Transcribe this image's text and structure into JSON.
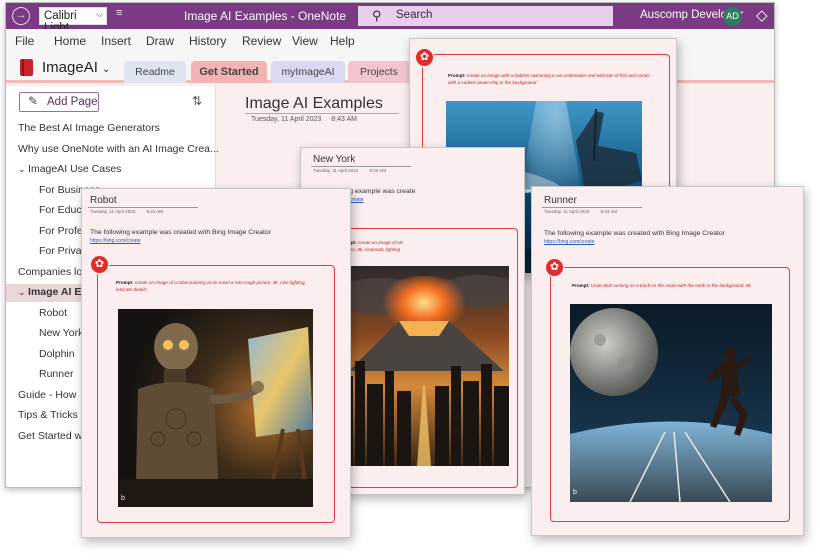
{
  "window": {
    "font_name": "Calibri Light",
    "title": "Image AI Examples  -  OneNote",
    "search_placeholder": "Search",
    "user_name": "Auscomp Developer",
    "user_initials": "AD"
  },
  "menu": [
    "File",
    "Home",
    "Insert",
    "Draw",
    "History",
    "Review",
    "View",
    "Help"
  ],
  "notebook": {
    "name": "ImageAI",
    "sections": [
      {
        "label": "Readme",
        "color": "#dfe4f3"
      },
      {
        "label": "Get Started",
        "color": "#f4b3b3"
      },
      {
        "label": "myImageAI",
        "color": "#dcd8ef"
      },
      {
        "label": "Projects",
        "color": "#f3c5cf"
      }
    ]
  },
  "sidebar": {
    "add_page": "Add Page",
    "pages": [
      {
        "label": "The Best AI Image Generators",
        "indent": 0
      },
      {
        "label": "Why use OneNote with an AI Image Crea...",
        "indent": 0
      },
      {
        "label": "ImageAI Use Cases",
        "indent": 0,
        "group": "expanded"
      },
      {
        "label": "For Business",
        "indent": 1
      },
      {
        "label": "For Educat",
        "indent": 1
      },
      {
        "label": "For Profess",
        "indent": 1
      },
      {
        "label": "For Private",
        "indent": 1
      },
      {
        "label": "Companies lo",
        "indent": 0
      },
      {
        "label": "Image AI Exa",
        "indent": 0,
        "group": "expanded",
        "selected": true
      },
      {
        "label": "Robot",
        "indent": 1
      },
      {
        "label": "New York",
        "indent": 1
      },
      {
        "label": "Dolphin",
        "indent": 1
      },
      {
        "label": "Runner",
        "indent": 1
      },
      {
        "label": "Guide - How",
        "indent": 0
      },
      {
        "label": "Tips & Tricks",
        "indent": 0
      },
      {
        "label": "Get Started w",
        "indent": 0
      }
    ]
  },
  "page": {
    "title": "Image AI Examples",
    "date": "Tuesday, 11 April 2023",
    "time": "8:43 AM"
  },
  "cards": {
    "robot": {
      "title": "Robot",
      "date": "Tuesday, 11 April 2023",
      "time": "8:43 AM",
      "intro": "The following example was created with Bing Image Creator",
      "link": "https://bing.com/create",
      "prompt_label": "Prompt:",
      "prompt": "create an image of a robot painting at an easel a Van Gogh picture, 8k, cine lighting, intricate details"
    },
    "newyork": {
      "title": "New York",
      "date": "Tuesday, 11 April 2023",
      "time": "8:43 AM",
      "intro": "The following example was create",
      "link": "https://bing.com/create",
      "prompt_label": "Prompt:",
      "prompt": "create an image of Ne volcano, 8k, cinematic lighting"
    },
    "dolphin": {
      "prompt_label": "Prompt:",
      "prompt": "create an image with a dolphin swimming in an underwater reef with lots of fish and corals with a sunken pirate ship in the background"
    },
    "runner": {
      "title": "Runner",
      "date": "Tuesday, 11 April 2023",
      "time": "8:43 AM",
      "intro": "The following example was created with Bing Image Creator",
      "link": "https://bing.com/create",
      "prompt_label": "Prompt:",
      "prompt": "Usain Bolt running on a track on the moon with the earth in the background, 8k"
    },
    "image_watermark": "b"
  },
  "colors": {
    "titlebar": "#7a3a84",
    "accent_red": "#e02c2c",
    "page_bg": "#fbeeee",
    "link_blue": "#2a5fc0"
  }
}
